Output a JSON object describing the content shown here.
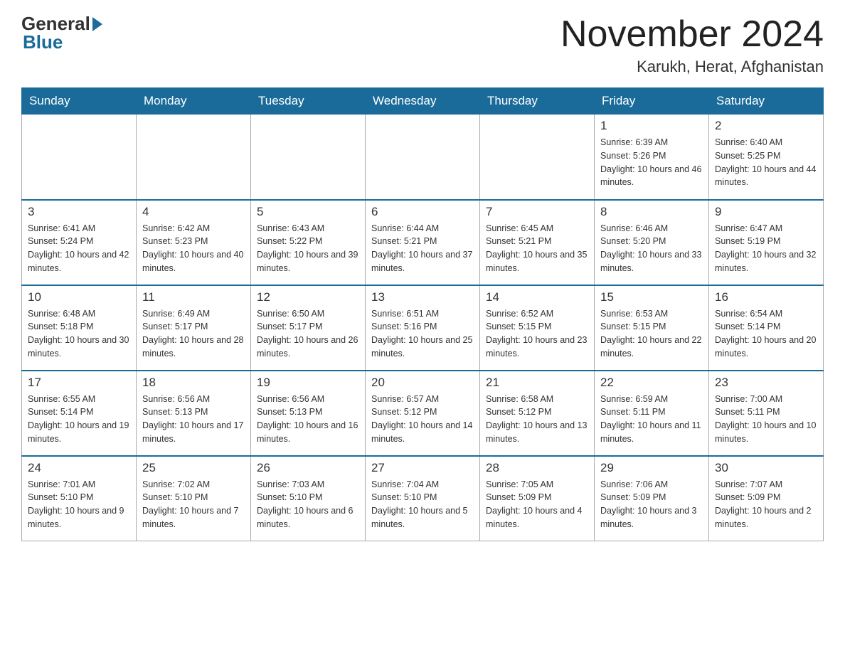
{
  "header": {
    "logo_general": "General",
    "logo_blue": "Blue",
    "month_title": "November 2024",
    "location": "Karukh, Herat, Afghanistan"
  },
  "days_of_week": [
    "Sunday",
    "Monday",
    "Tuesday",
    "Wednesday",
    "Thursday",
    "Friday",
    "Saturday"
  ],
  "weeks": [
    [
      {
        "day": "",
        "info": ""
      },
      {
        "day": "",
        "info": ""
      },
      {
        "day": "",
        "info": ""
      },
      {
        "day": "",
        "info": ""
      },
      {
        "day": "",
        "info": ""
      },
      {
        "day": "1",
        "info": "Sunrise: 6:39 AM\nSunset: 5:26 PM\nDaylight: 10 hours and 46 minutes."
      },
      {
        "day": "2",
        "info": "Sunrise: 6:40 AM\nSunset: 5:25 PM\nDaylight: 10 hours and 44 minutes."
      }
    ],
    [
      {
        "day": "3",
        "info": "Sunrise: 6:41 AM\nSunset: 5:24 PM\nDaylight: 10 hours and 42 minutes."
      },
      {
        "day": "4",
        "info": "Sunrise: 6:42 AM\nSunset: 5:23 PM\nDaylight: 10 hours and 40 minutes."
      },
      {
        "day": "5",
        "info": "Sunrise: 6:43 AM\nSunset: 5:22 PM\nDaylight: 10 hours and 39 minutes."
      },
      {
        "day": "6",
        "info": "Sunrise: 6:44 AM\nSunset: 5:21 PM\nDaylight: 10 hours and 37 minutes."
      },
      {
        "day": "7",
        "info": "Sunrise: 6:45 AM\nSunset: 5:21 PM\nDaylight: 10 hours and 35 minutes."
      },
      {
        "day": "8",
        "info": "Sunrise: 6:46 AM\nSunset: 5:20 PM\nDaylight: 10 hours and 33 minutes."
      },
      {
        "day": "9",
        "info": "Sunrise: 6:47 AM\nSunset: 5:19 PM\nDaylight: 10 hours and 32 minutes."
      }
    ],
    [
      {
        "day": "10",
        "info": "Sunrise: 6:48 AM\nSunset: 5:18 PM\nDaylight: 10 hours and 30 minutes."
      },
      {
        "day": "11",
        "info": "Sunrise: 6:49 AM\nSunset: 5:17 PM\nDaylight: 10 hours and 28 minutes."
      },
      {
        "day": "12",
        "info": "Sunrise: 6:50 AM\nSunset: 5:17 PM\nDaylight: 10 hours and 26 minutes."
      },
      {
        "day": "13",
        "info": "Sunrise: 6:51 AM\nSunset: 5:16 PM\nDaylight: 10 hours and 25 minutes."
      },
      {
        "day": "14",
        "info": "Sunrise: 6:52 AM\nSunset: 5:15 PM\nDaylight: 10 hours and 23 minutes."
      },
      {
        "day": "15",
        "info": "Sunrise: 6:53 AM\nSunset: 5:15 PM\nDaylight: 10 hours and 22 minutes."
      },
      {
        "day": "16",
        "info": "Sunrise: 6:54 AM\nSunset: 5:14 PM\nDaylight: 10 hours and 20 minutes."
      }
    ],
    [
      {
        "day": "17",
        "info": "Sunrise: 6:55 AM\nSunset: 5:14 PM\nDaylight: 10 hours and 19 minutes."
      },
      {
        "day": "18",
        "info": "Sunrise: 6:56 AM\nSunset: 5:13 PM\nDaylight: 10 hours and 17 minutes."
      },
      {
        "day": "19",
        "info": "Sunrise: 6:56 AM\nSunset: 5:13 PM\nDaylight: 10 hours and 16 minutes."
      },
      {
        "day": "20",
        "info": "Sunrise: 6:57 AM\nSunset: 5:12 PM\nDaylight: 10 hours and 14 minutes."
      },
      {
        "day": "21",
        "info": "Sunrise: 6:58 AM\nSunset: 5:12 PM\nDaylight: 10 hours and 13 minutes."
      },
      {
        "day": "22",
        "info": "Sunrise: 6:59 AM\nSunset: 5:11 PM\nDaylight: 10 hours and 11 minutes."
      },
      {
        "day": "23",
        "info": "Sunrise: 7:00 AM\nSunset: 5:11 PM\nDaylight: 10 hours and 10 minutes."
      }
    ],
    [
      {
        "day": "24",
        "info": "Sunrise: 7:01 AM\nSunset: 5:10 PM\nDaylight: 10 hours and 9 minutes."
      },
      {
        "day": "25",
        "info": "Sunrise: 7:02 AM\nSunset: 5:10 PM\nDaylight: 10 hours and 7 minutes."
      },
      {
        "day": "26",
        "info": "Sunrise: 7:03 AM\nSunset: 5:10 PM\nDaylight: 10 hours and 6 minutes."
      },
      {
        "day": "27",
        "info": "Sunrise: 7:04 AM\nSunset: 5:10 PM\nDaylight: 10 hours and 5 minutes."
      },
      {
        "day": "28",
        "info": "Sunrise: 7:05 AM\nSunset: 5:09 PM\nDaylight: 10 hours and 4 minutes."
      },
      {
        "day": "29",
        "info": "Sunrise: 7:06 AM\nSunset: 5:09 PM\nDaylight: 10 hours and 3 minutes."
      },
      {
        "day": "30",
        "info": "Sunrise: 7:07 AM\nSunset: 5:09 PM\nDaylight: 10 hours and 2 minutes."
      }
    ]
  ]
}
